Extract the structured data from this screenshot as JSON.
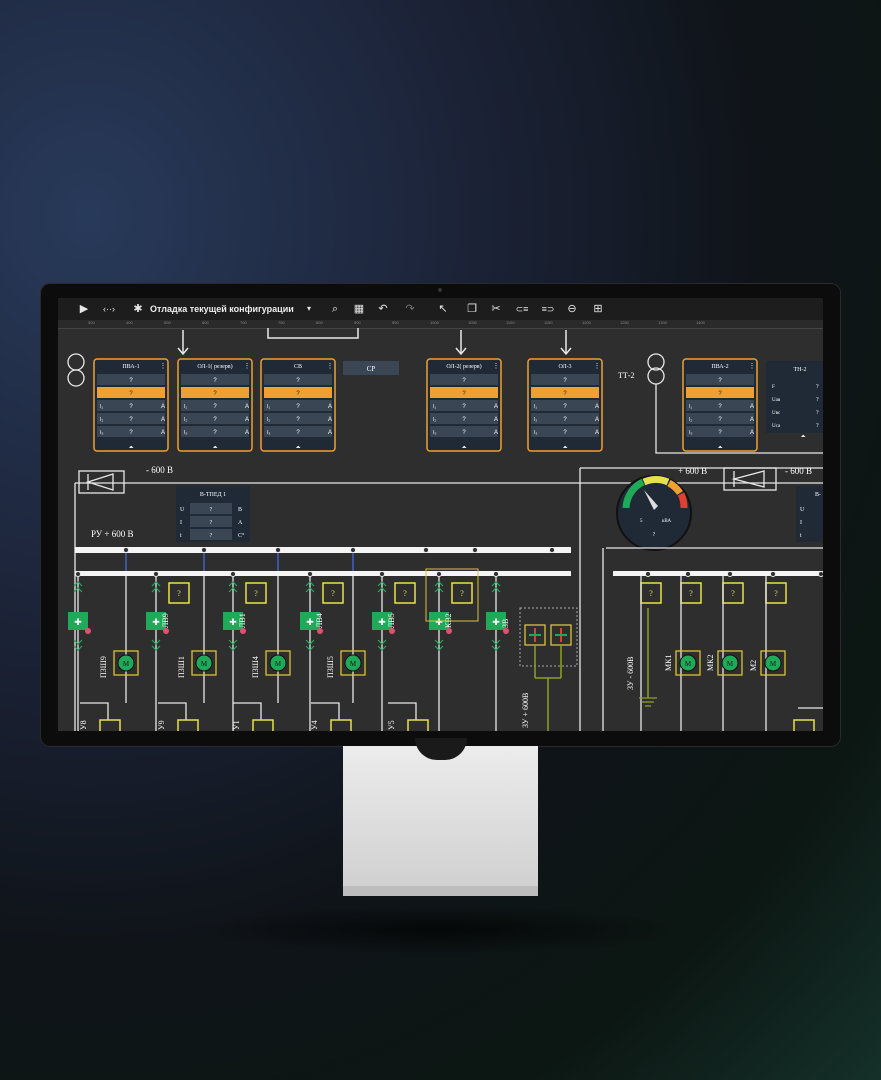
{
  "toolbar": {
    "title": "Отладка текущей конфигурации",
    "play_icon": "play-icon",
    "code_label": "‹··›"
  },
  "ruler_ticks": [
    "300",
    "400",
    "500",
    "600",
    "700",
    "750",
    "800",
    "900",
    "950",
    "1000",
    "1050",
    "1100",
    "1150",
    "1200",
    "1250",
    "1300",
    "1400"
  ],
  "top_panels": [
    {
      "title": "ПВА-1",
      "rows": [
        "?",
        "?",
        "?",
        "?",
        "?"
      ],
      "units": [
        "",
        "",
        "A",
        "A",
        "A"
      ],
      "row_prefix": [
        "",
        "",
        "I₁",
        "I₂",
        "I₃"
      ],
      "highlight": 1
    },
    {
      "title": "ОЛ-1( резерв)",
      "rows": [
        "?",
        "?",
        "?",
        "?",
        "?"
      ],
      "units": [
        "",
        "",
        "A",
        "A",
        "A"
      ],
      "row_prefix": [
        "",
        "",
        "I₁",
        "I₂",
        "I₃"
      ],
      "highlight": 1
    },
    {
      "title": "СВ",
      "rows": [
        "?",
        "?",
        "?",
        "?",
        "?"
      ],
      "units": [
        "",
        "",
        "A",
        "A",
        "A"
      ],
      "row_prefix": [
        "",
        "",
        "I₁",
        "I₂",
        "I₃"
      ],
      "highlight": 1
    },
    {
      "title": "ОЛ-2( резерв)",
      "rows": [
        "?",
        "?",
        "?",
        "?",
        "?"
      ],
      "units": [
        "",
        "",
        "A",
        "A",
        "A"
      ],
      "row_prefix": [
        "",
        "",
        "I₁",
        "I₂",
        "I₃"
      ],
      "highlight": 1
    },
    {
      "title": "ОЛ-3",
      "rows": [
        "?",
        "?",
        "?",
        "?",
        "?"
      ],
      "units": [
        "",
        "",
        "A",
        "A",
        "A"
      ],
      "row_prefix": [
        "",
        "",
        "I₁",
        "I₂",
        "I₃"
      ],
      "highlight": 1
    },
    {
      "title": "ПВА-2",
      "rows": [
        "?",
        "?",
        "?",
        "?",
        "?"
      ],
      "units": [
        "",
        "",
        "A",
        "A",
        "A"
      ],
      "row_prefix": [
        "",
        "",
        "I₁",
        "I₂",
        "I₃"
      ],
      "highlight": 1
    }
  ],
  "sr_label": "СР",
  "tn2": {
    "title": "ТН-2",
    "labels": [
      "F",
      "Uав",
      "Uвс",
      "Uса"
    ],
    "values": [
      "?",
      "?",
      "?",
      "?"
    ]
  },
  "tt2_label": "ТТ-2",
  "bus_labels": {
    "minus_left": "- 600 В",
    "plus_right": "+ 600 В",
    "minus_right": "- 600 В",
    "ru": "РУ + 600 В"
  },
  "btped": {
    "title": "В-ТПЕД 1",
    "labels": [
      "U",
      "I",
      "t"
    ],
    "values": [
      "?",
      "?",
      "?"
    ],
    "units": [
      "В",
      "А",
      "С°"
    ]
  },
  "gauge": {
    "value": "5",
    "unit": "кВА",
    "reading": "?"
  },
  "feeders": [
    "ЛВ9",
    "ЛВ1",
    "ЛВ4",
    "ЛВ5",
    "КВ2",
    "ЗВ"
  ],
  "motors": [
    "ПЗШ9",
    "ПЗШ1",
    "ПЗШ4",
    "ПЗШ5"
  ],
  "bottom_labels": [
    "У8",
    "У9",
    "У1",
    "У4",
    "У5"
  ],
  "zu_labels": [
    "ЗУ + 600В",
    "ЗУ - 600В"
  ],
  "right_motors": [
    "МК1",
    "МК2",
    "М2"
  ],
  "q_mark": "?",
  "colors": {
    "accent": "#f0a030",
    "screen_bg": "#2e2e2f",
    "green": "#1faa5a",
    "yellow": "#e8e04a"
  }
}
